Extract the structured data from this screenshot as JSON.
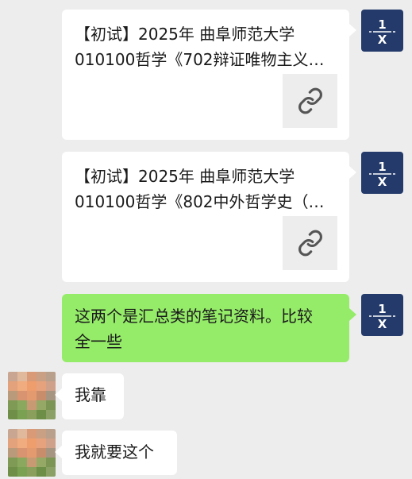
{
  "messages": [
    {
      "sender": "self",
      "kind": "link-card",
      "title_line1": "【初试】2025年 曲阜师范大学",
      "title_line2": "010100哲学《702辩证唯物主义…",
      "icon": "link-icon"
    },
    {
      "sender": "self",
      "kind": "link-card",
      "title_line1": "【初试】2025年 曲阜师范大学",
      "title_line2": "010100哲学《802中外哲学史（…",
      "icon": "link-icon"
    },
    {
      "sender": "self",
      "kind": "text",
      "line1": "这两个是汇总类的笔记资料。比较",
      "line2": "全一些"
    },
    {
      "sender": "other",
      "kind": "text",
      "text": "我靠"
    },
    {
      "sender": "other",
      "kind": "text",
      "text": "我就要这个"
    }
  ],
  "self_avatar": {
    "top": "1",
    "bottom": "X",
    "bg": "#233a6a",
    "fg": "#ffffff"
  },
  "colors": {
    "background": "#ededed",
    "bubble_self_text": "#95ec69",
    "bubble_white": "#ffffff",
    "link_box": "#ededed"
  }
}
